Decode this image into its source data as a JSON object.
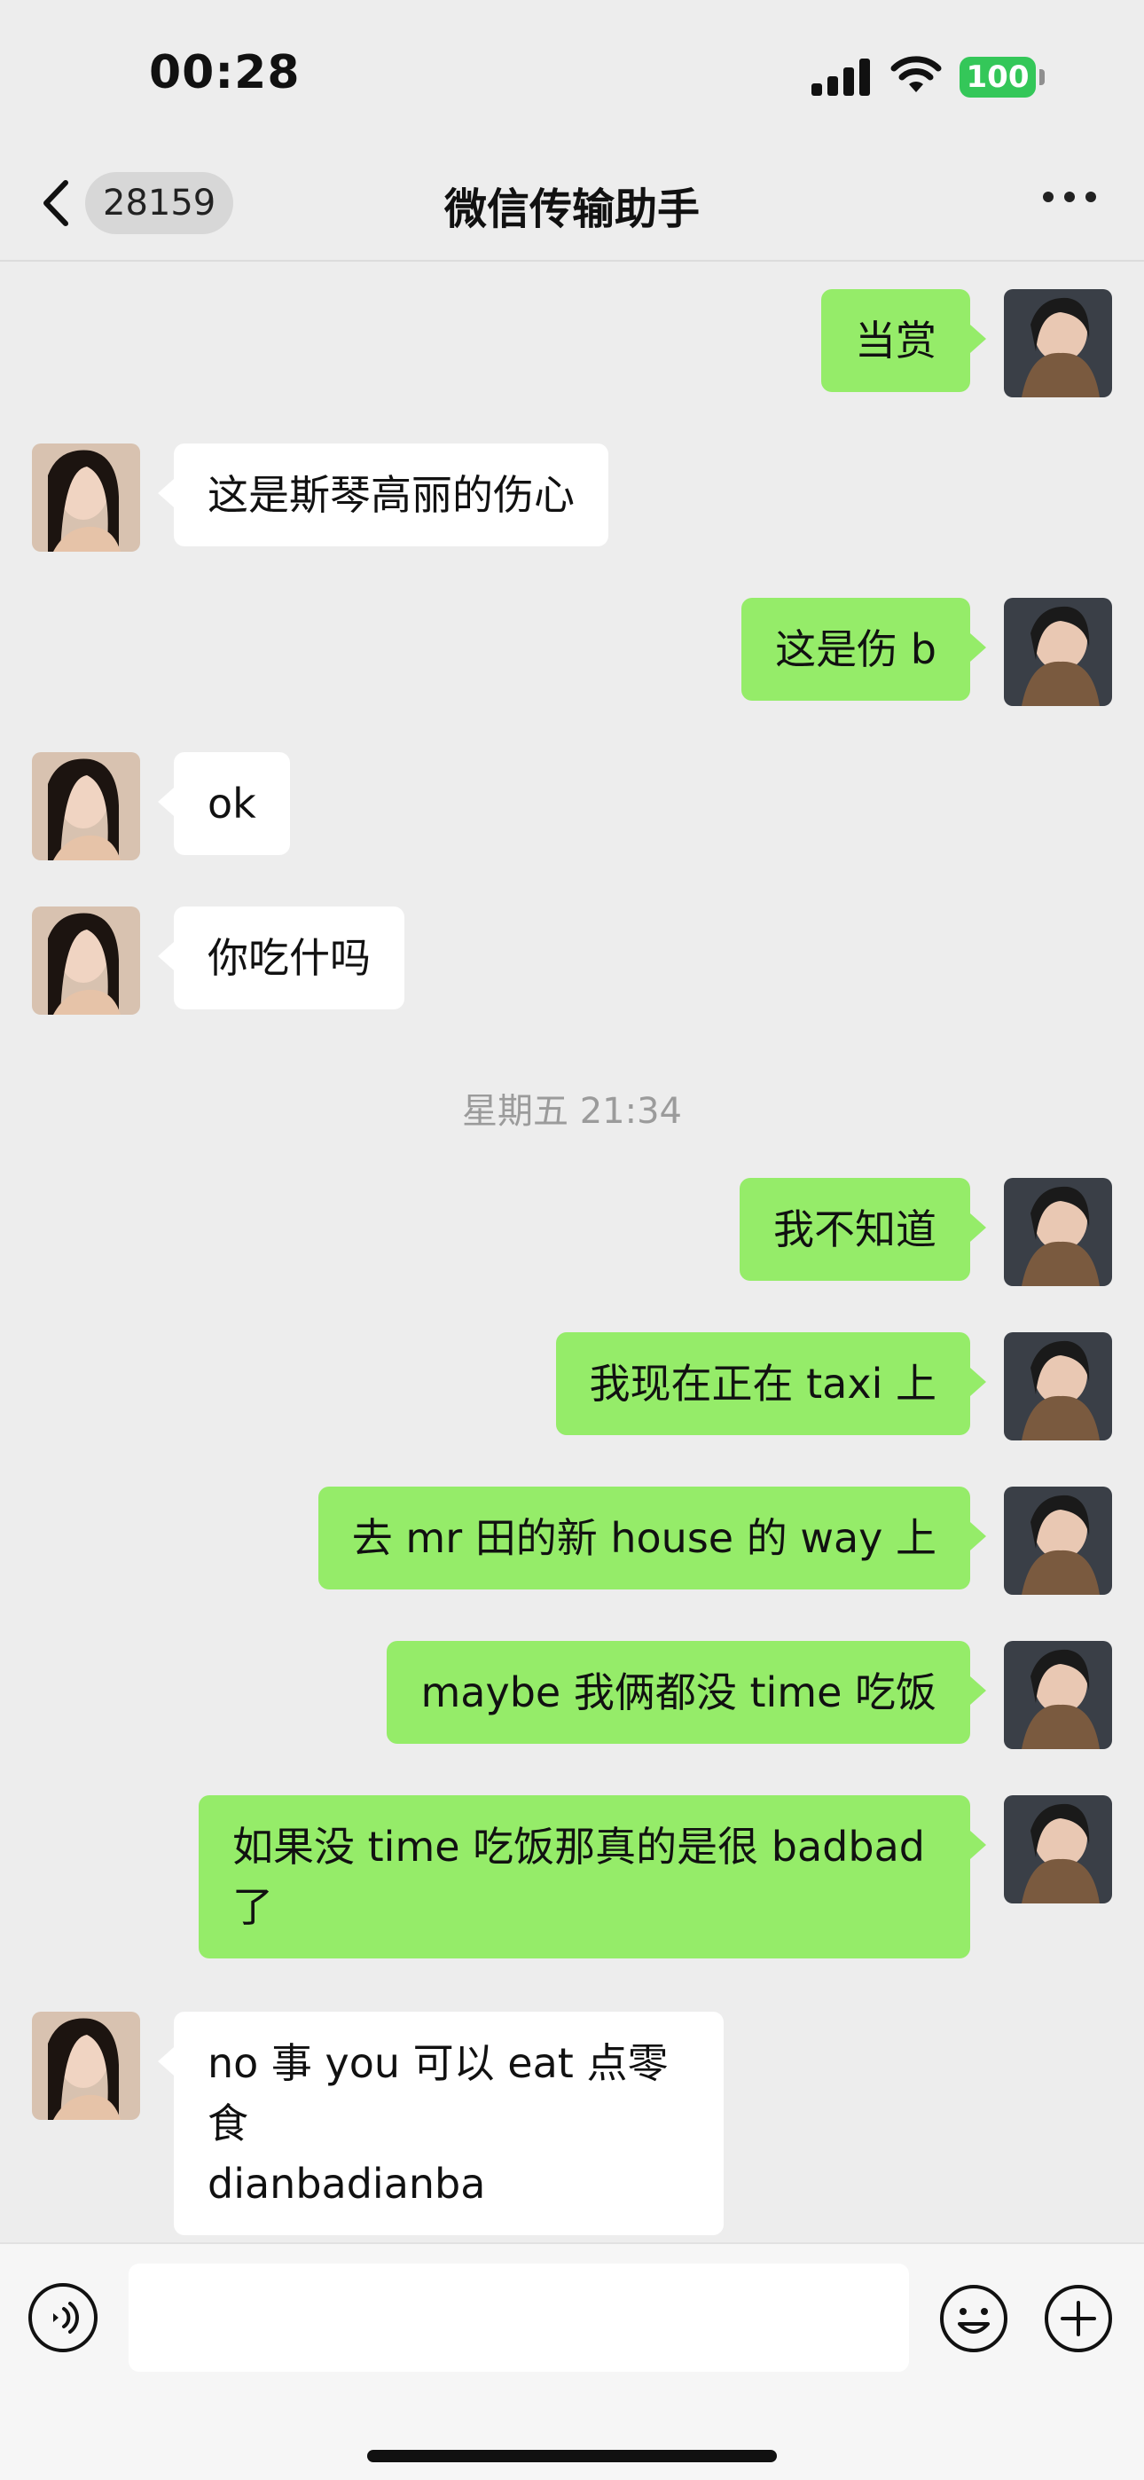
{
  "status_bar": {
    "time": "00:28",
    "battery": "100"
  },
  "nav": {
    "unread_count": "28159",
    "title": "微信传输助手"
  },
  "colors": {
    "outgoing_bubble": "#95ec69",
    "incoming_bubble": "#ffffff",
    "background": "#ededed",
    "battery": "#34c759"
  },
  "timestamp": "星期五 21:34",
  "messages": [
    {
      "side": "out",
      "text": "当赏"
    },
    {
      "side": "in",
      "text": "这是斯琴高丽的伤心"
    },
    {
      "side": "out",
      "text": "这是伤 b"
    },
    {
      "side": "in",
      "text": "ok"
    },
    {
      "side": "in",
      "text": "你吃什吗"
    },
    {
      "side": "out",
      "text": "我不知道"
    },
    {
      "side": "out",
      "text": "我现在正在 taxi 上"
    },
    {
      "side": "out",
      "text": "去 mr 田的新 house 的 way 上"
    },
    {
      "side": "out",
      "text": "maybe 我俩都没 time 吃饭"
    },
    {
      "side": "out",
      "text": "如果没 time 吃饭那真的是很 badbad\n了"
    },
    {
      "side": "in",
      "text": "no 事 you 可以 eat 点零食\ndianbadianba"
    }
  ],
  "input": {
    "placeholder": ""
  },
  "icons": {
    "back": "chevron-left-icon",
    "more": "more-icon",
    "voice": "voice-icon",
    "emoji": "emoji-icon",
    "plus": "plus-icon"
  }
}
